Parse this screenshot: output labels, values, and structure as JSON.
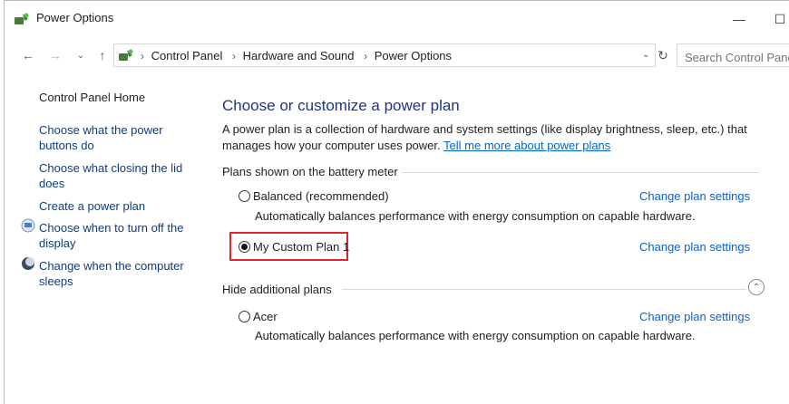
{
  "window": {
    "title": "Power Options"
  },
  "address": {
    "crumbs": [
      "Control Panel",
      "Hardware and Sound",
      "Power Options"
    ],
    "search_placeholder": "Search Control Panel"
  },
  "sidebar": {
    "items": [
      {
        "label": "Control Panel Home"
      },
      {
        "label": "Choose what the power buttons do"
      },
      {
        "label": "Choose what closing the lid does"
      },
      {
        "label": "Create a power plan"
      },
      {
        "label": "Choose when to turn off the display"
      },
      {
        "label": "Change when the computer sleeps"
      }
    ]
  },
  "main": {
    "title": "Choose or customize a power plan",
    "description": "A power plan is a collection of hardware and system settings (like display brightness, sleep, etc.) that manages how your computer uses power.",
    "learn_more": "Tell me more about power plans",
    "battery_section": "Plans shown on the battery meter",
    "hide_section": "Hide additional plans",
    "change_label": "Change plan settings",
    "plans": [
      {
        "name": "Balanced (recommended)",
        "description": "Automatically balances performance with energy consumption on capable hardware.",
        "selected": false
      },
      {
        "name": "My Custom Plan 1",
        "description": "",
        "selected": true
      },
      {
        "name": "Acer",
        "description": "Automatically balances performance with energy consumption on capable hardware.",
        "selected": false
      }
    ]
  },
  "colors": {
    "link": "#0c62c9",
    "heading": "#1e3287",
    "highlight": "#e0262b"
  }
}
